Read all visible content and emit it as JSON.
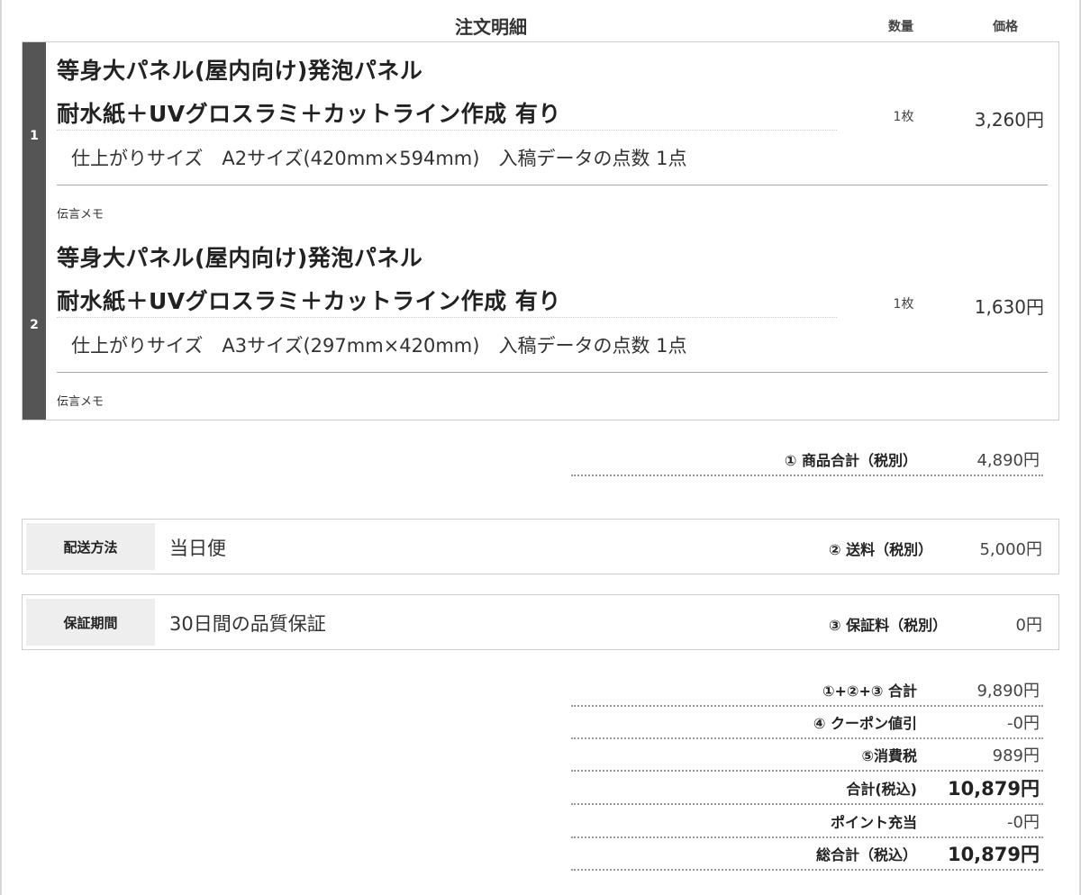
{
  "header": {
    "title": "注文明細",
    "qty_label": "数量",
    "price_label": "価格"
  },
  "items": [
    {
      "number": "1",
      "name_line1": "等身大パネル(屋内向け)発泡パネル",
      "name_line2": "耐水紙＋UVグロスラミ＋カットライン作成 有り",
      "spec": "仕上がりサイズ　A2サイズ(420mm×594mm)　入稿データの点数  1点",
      "qty": "1枚",
      "price": "3,260円",
      "memo_label": "伝言メモ"
    },
    {
      "number": "2",
      "name_line1": "等身大パネル(屋内向け)発泡パネル",
      "name_line2": "耐水紙＋UVグロスラミ＋カットライン作成 有り",
      "spec": "仕上がりサイズ　A3サイズ(297mm×420mm)　入稿データの点数  1点",
      "qty": "1枚",
      "price": "1,630円",
      "memo_label": "伝言メモ"
    }
  ],
  "subtotal": {
    "label": "① 商品合計（税別）",
    "value": "4,890円"
  },
  "shipping": {
    "header": "配送方法",
    "value": "当日便",
    "fee_label": "② 送料（税別）",
    "fee": "5,000円"
  },
  "warranty": {
    "header": "保証期間",
    "value": "30日間の品質保証",
    "fee_label": "③ 保証料（税別）",
    "fee": "0円"
  },
  "totals": [
    {
      "label": "①+②+③ 合計",
      "value": "9,890円"
    },
    {
      "label": "④ クーポン値引",
      "value": "-0円"
    },
    {
      "label": "⑤消費税",
      "value": "989円"
    },
    {
      "label": "合計(税込)",
      "value": "10,879円"
    },
    {
      "label": "ポイント充当",
      "value": "-0円"
    },
    {
      "label": "総合計（税込）",
      "value": "10,879円"
    }
  ],
  "colors": {
    "number_band": "#555555",
    "option_header_bg": "#eeeeee",
    "border": "#cfcfcf"
  }
}
